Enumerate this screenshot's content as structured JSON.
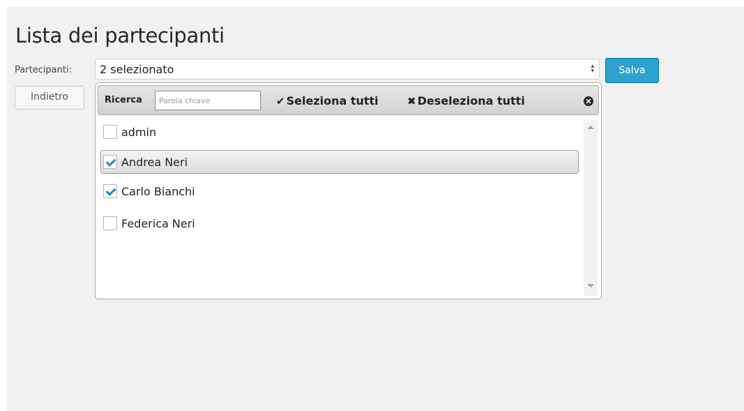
{
  "page": {
    "title": "Lista dei partecipanti"
  },
  "form": {
    "participants_label": "Partecipanti:",
    "selected_summary": "2 selezionato",
    "save_label": "Salva",
    "back_label": "Indietro"
  },
  "dropdown": {
    "search_label": "Ricerca",
    "search_placeholder": "Parola chiave",
    "search_value": "",
    "select_all_icon": "check-icon",
    "select_all_glyph": "✔",
    "select_all_label": "Seleziona tutti",
    "deselect_all_icon": "x-icon",
    "deselect_all_glyph": "✖",
    "deselect_all_label": "Deseleziona tutti",
    "close_icon": "close-circle-icon",
    "options": [
      {
        "label": "admin",
        "checked": false,
        "hovered": false
      },
      {
        "label": "Andrea Neri",
        "checked": true,
        "hovered": true
      },
      {
        "label": "Carlo Bianchi",
        "checked": true,
        "hovered": false
      },
      {
        "label": "Federica Neri",
        "checked": false,
        "hovered": false
      }
    ]
  },
  "colors": {
    "page_background": "#f1f1f1",
    "primary_button": "#2ea2cc",
    "checkmark": "#1e8cbe"
  }
}
